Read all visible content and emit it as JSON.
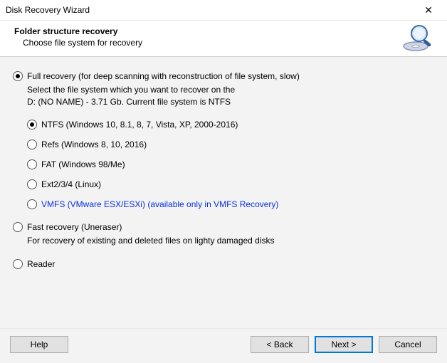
{
  "window": {
    "title": "Disk Recovery Wizard"
  },
  "header": {
    "heading": "Folder structure recovery",
    "subheading": "Choose file system for recovery"
  },
  "modes": {
    "full": {
      "label": "Full recovery (for deep scanning with reconstruction of file system, slow)",
      "desc_line1": "Select the file system which you want to recover on the",
      "desc_line2": "D: (NO NAME) - 3.71 Gb. Current file system is NTFS",
      "selected": true
    },
    "fast": {
      "label": "Fast recovery (Uneraser)",
      "desc": "For recovery of existing and deleted files on lighty damaged disks",
      "selected": false
    },
    "reader": {
      "label": "Reader",
      "selected": false
    }
  },
  "filesystems": {
    "ntfs": {
      "label": "NTFS (Windows 10, 8.1, 8, 7, Vista, XP, 2000-2016)",
      "selected": true
    },
    "refs": {
      "label": "Refs (Windows 8, 10, 2016)",
      "selected": false
    },
    "fat": {
      "label": "FAT (Windows 98/Me)",
      "selected": false
    },
    "ext": {
      "label": "Ext2/3/4 (Linux)",
      "selected": false
    },
    "vmfs": {
      "label": "VMFS (VMware ESX/ESXi) (available only in VMFS Recovery)",
      "selected": false
    }
  },
  "buttons": {
    "help": "Help",
    "back": "< Back",
    "next": "Next >",
    "cancel": "Cancel"
  }
}
